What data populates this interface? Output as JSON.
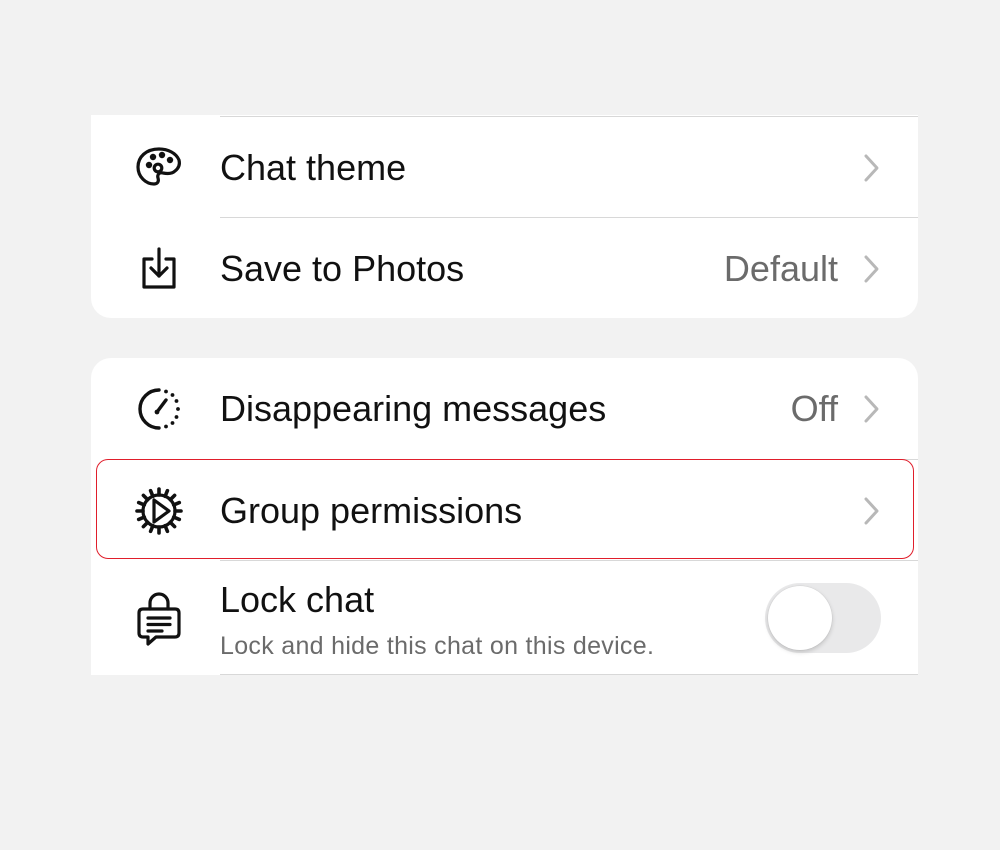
{
  "colors": {
    "background": "#f2f2f2",
    "card": "#ffffff",
    "text_primary": "#111111",
    "text_secondary": "#6b6b6b",
    "chevron": "#b8b8b8",
    "divider": "#d8d8d8",
    "highlight": "#e01e2b",
    "toggle_off": "#e9e9ea"
  },
  "media_section": {
    "items": [
      {
        "label": "Chat theme",
        "icon": "palette-icon",
        "value": "",
        "has_chevron": true
      },
      {
        "label": "Save to Photos",
        "icon": "save-download-icon",
        "value": "Default",
        "has_chevron": true
      }
    ]
  },
  "privacy_section": {
    "items": [
      {
        "label": "Disappearing messages",
        "icon": "timer-icon",
        "value": "Off",
        "has_chevron": true
      },
      {
        "label": "Group permissions",
        "icon": "gear-icon",
        "value": "",
        "has_chevron": true,
        "highlighted": true
      }
    ],
    "lock_chat": {
      "label": "Lock chat",
      "description": "Lock and hide this chat on this device.",
      "icon": "lock-chat-icon",
      "toggle_on": false
    }
  }
}
